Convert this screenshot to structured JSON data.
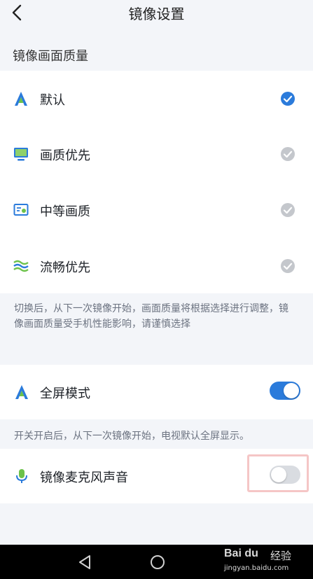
{
  "header": {
    "title": "镜像设置"
  },
  "quality": {
    "section_label": "镜像画面质量",
    "options": [
      {
        "label": "默认",
        "icon": "letter-a-icon",
        "selected": true
      },
      {
        "label": "画质优先",
        "icon": "monitor-icon",
        "selected": false
      },
      {
        "label": "中等画质",
        "icon": "screen-card-icon",
        "selected": false
      },
      {
        "label": "流畅优先",
        "icon": "waves-icon",
        "selected": false
      }
    ],
    "note": "切换后，从下一次镜像开始，画面质量将根据选择进行调整，镜像画面质量受手机性能影响，请谨慎选择"
  },
  "fullscreen": {
    "label": "全屏模式",
    "enabled": true,
    "note": "开关开启后，从下一次镜像开始，电视默认全屏显示。"
  },
  "mic": {
    "label": "镜像麦克风声音",
    "enabled": false
  },
  "colors": {
    "accent": "#2b7bdb",
    "check_inactive": "#c4c7cc",
    "icon_green": "#6cc24a",
    "toggle_off": "#d9dce1"
  },
  "watermark": {
    "logo": "Bai du",
    "text": "经验",
    "url": "jingyan.baidu.com"
  }
}
